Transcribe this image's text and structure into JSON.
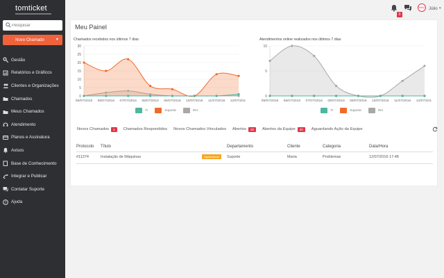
{
  "app": {
    "logo": "tomticket"
  },
  "sidebar": {
    "search_placeholder": "Pesquisar",
    "new_ticket_label": "Novo Chamado",
    "items": [
      {
        "label": "Gestão",
        "icon": "key-icon"
      },
      {
        "label": "Relatórios e Gráficos",
        "icon": "chart-icon"
      },
      {
        "label": "Clientes e Organizações",
        "icon": "users-icon"
      },
      {
        "label": "Chamados",
        "icon": "folder-icon"
      },
      {
        "label": "Meus Chamados",
        "icon": "folder-icon"
      },
      {
        "label": "Atendimento",
        "icon": "headset-icon"
      },
      {
        "label": "Planos e Assinatura",
        "icon": "card-icon"
      },
      {
        "label": "Avisos",
        "icon": "bell-icon"
      },
      {
        "label": "Base de Conhecimento",
        "icon": "book-icon"
      },
      {
        "label": "Integrar e Publicar",
        "icon": "plug-icon"
      },
      {
        "label": "Contatar Suporte",
        "icon": "chat-icon"
      },
      {
        "label": "Ajuda",
        "icon": "help-icon"
      }
    ]
  },
  "topbar": {
    "notification_count": "0",
    "user_name": "Júlio",
    "avatar_text": "MAU"
  },
  "panel": {
    "title": "Meu Painel"
  },
  "colors": {
    "teal": "#4fb6a0",
    "orange": "#f06a2a",
    "gray": "#a8a8a8",
    "accent": "#f0623b",
    "badge": "#e0364a"
  },
  "chart_data": [
    {
      "type": "area",
      "title": "Chamados recebidos nos últimos 7 dias",
      "categories": [
        "05/07/2016",
        "06/07/2016",
        "07/07/2016",
        "08/07/2016",
        "09/07/2016",
        "10/07/2016",
        "11/07/2016",
        "12/07/2016"
      ],
      "ylim": [
        0,
        30
      ],
      "yticks": [
        0,
        5,
        10,
        15,
        20,
        25,
        30
      ],
      "series": [
        {
          "name": "TI",
          "color": "#4fb6a0",
          "values": [
            0,
            0,
            0,
            0,
            0,
            0,
            0,
            1
          ]
        },
        {
          "name": "Suporte",
          "color": "#f06a2a",
          "values": [
            20,
            15,
            22,
            6,
            4,
            0,
            13,
            12
          ]
        },
        {
          "name": "RH",
          "color": "#a8a8a8",
          "values": [
            0,
            2,
            3,
            1,
            0,
            0,
            0,
            0
          ]
        }
      ]
    },
    {
      "type": "area",
      "title": "Atendimentos online realizados nos últimos 7 dias",
      "categories": [
        "05/07/2016",
        "06/07/2016",
        "07/07/2016",
        "08/07/2016",
        "09/07/2016",
        "10/07/2016",
        "11/07/2016",
        "12/07/2016"
      ],
      "ylim": [
        0,
        10
      ],
      "yticks": [
        0,
        5,
        10
      ],
      "series": [
        {
          "name": "TI",
          "color": "#4fb6a0",
          "values": [
            0,
            0,
            0,
            0,
            0,
            0,
            0,
            0
          ]
        },
        {
          "name": "Suporte",
          "color": "#f06a2a",
          "values": [
            0,
            0,
            0,
            0,
            0,
            0,
            0,
            0
          ]
        },
        {
          "name": "RH",
          "color": "#a8a8a8",
          "values": [
            7,
            10,
            8,
            2,
            0,
            0,
            3,
            6
          ]
        }
      ]
    }
  ],
  "tabs": [
    {
      "label": "Novos Chamados",
      "count": "1"
    },
    {
      "label": "Chamados Respondidos",
      "count": ""
    },
    {
      "label": "Novos Chamados Vinculados",
      "count": ""
    },
    {
      "label": "Abertos",
      "count": "20"
    },
    {
      "label": "Abertos da Equipe",
      "count": "20"
    },
    {
      "label": "Aguardando Ação da Equipe",
      "count": ""
    }
  ],
  "table": {
    "headers": [
      "Protocolo",
      "Título",
      "Departamento",
      "Cliente",
      "Categoria",
      "Data/Hora"
    ],
    "rows": [
      {
        "protocolo": "#11374",
        "titulo": "Instalação de Máquinas",
        "status": "Aguardando",
        "departamento": "Suporte",
        "cliente": "Maria",
        "categoria": "Problemas",
        "datahora": "12/07/2016 17:48"
      }
    ]
  }
}
